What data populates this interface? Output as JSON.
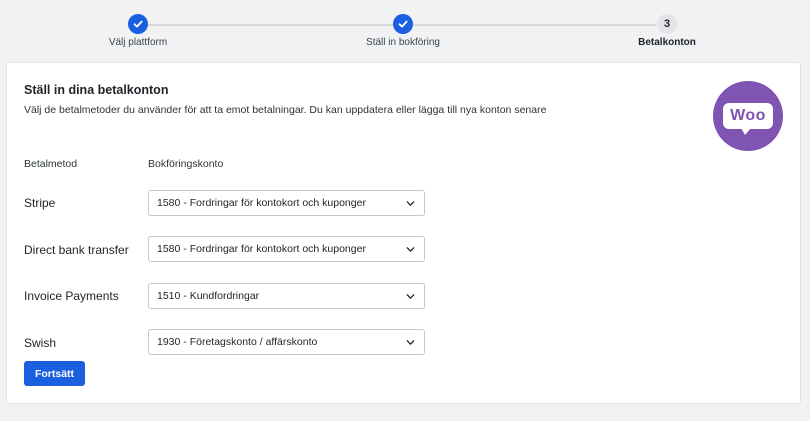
{
  "stepper": {
    "steps": [
      {
        "label": "Välj plattform",
        "status": "done"
      },
      {
        "label": "Ställ in bokföring",
        "status": "done"
      },
      {
        "label": "Betalkonton",
        "status": "current",
        "number": "3"
      }
    ]
  },
  "card": {
    "title": "Ställ in dina betalkonton",
    "description": "Välj de betalmetoder du använder för att ta emot betalningar. Du kan uppdatera eller lägga till nya konton senare",
    "logo_text": "Woo",
    "columns": {
      "method": "Betalmetod",
      "account": "Bokföringskonto"
    },
    "rows": [
      {
        "method": "Stripe",
        "account": "1580 - Fordringar för kontokort och kuponger"
      },
      {
        "method": "Direct bank transfer",
        "account": "1580 - Fordringar för kontokort och kuponger"
      },
      {
        "method": "Invoice Payments",
        "account": "1510 - Kundfordringar"
      },
      {
        "method": "Swish",
        "account": "1930 - Företagskonto / affärskonto"
      }
    ],
    "continue_label": "Fortsätt"
  },
  "colors": {
    "accent": "#1a5fe0",
    "woo_purple": "#7f54b3",
    "background": "#f1f2f4"
  }
}
